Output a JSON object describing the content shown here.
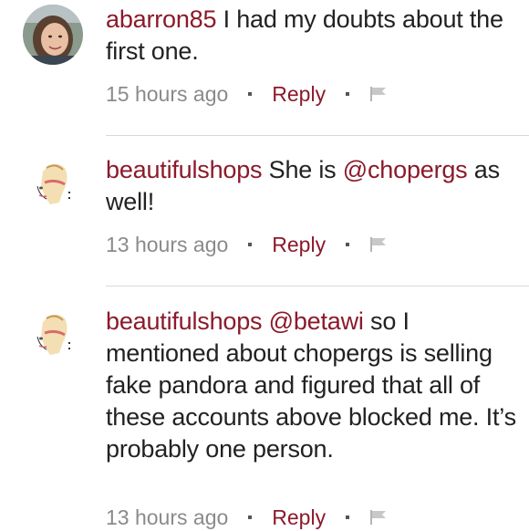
{
  "comments": [
    {
      "username": "abarron85",
      "text_parts": [
        " I had my doubts about the first one."
      ],
      "time": "15 hours ago",
      "reply_label": "Reply",
      "avatar": "woman-photo-avatar"
    },
    {
      "username": "beautifulshops",
      "text_before": " She is ",
      "mention": "@chopergs",
      "text_after": " as well!",
      "time": "13 hours ago",
      "reply_label": "Reply",
      "avatar": "sketch-girl-avatar"
    },
    {
      "username": "beautifulshops",
      "mention": "@betawi",
      "text_after": " so I mentioned about chopergs is selling fake pandora and figured that all of these accounts above blocked me. It’s probably one person.",
      "time": "13 hours ago",
      "reply_label": "Reply",
      "avatar": "sketch-girl-avatar"
    }
  ],
  "colors": {
    "accent": "#8b1a2b",
    "meta_text": "#8a8a8a",
    "divider": "#d8d8d8"
  },
  "icons": {
    "flag": "flag-icon"
  }
}
